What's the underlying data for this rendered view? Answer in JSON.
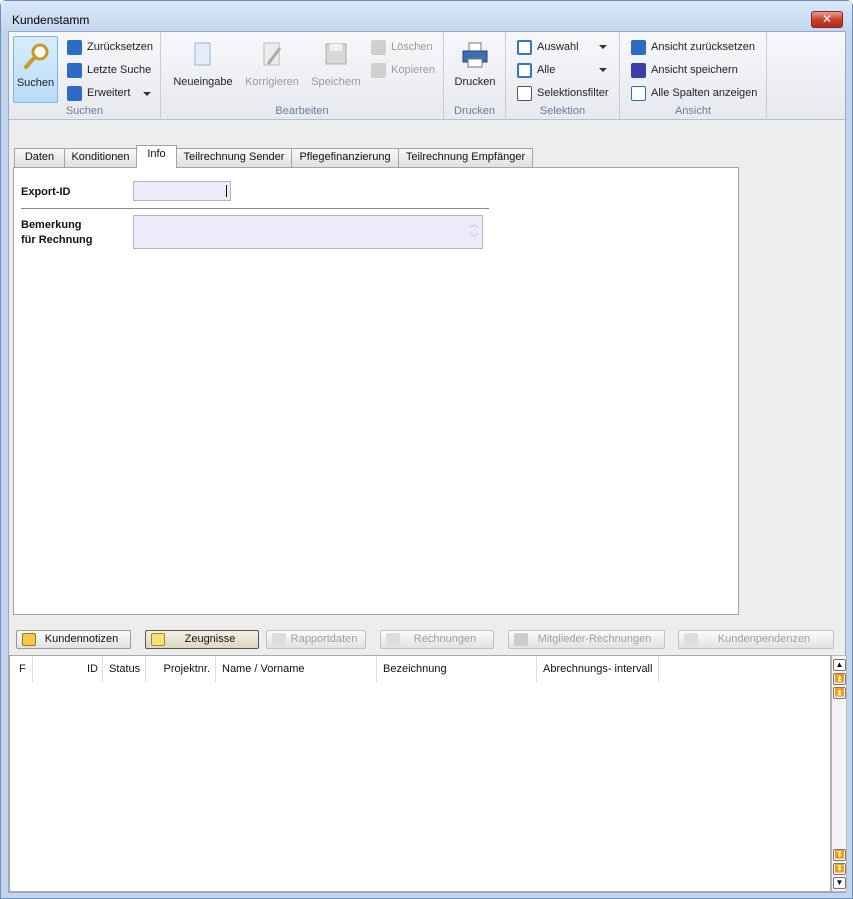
{
  "window": {
    "title": "Kundenstamm",
    "close_label": "✕"
  },
  "ribbon": {
    "suchen": {
      "label": "Suchen",
      "search_label": "Suchen",
      "reset_label": "Zurücksetzen",
      "last_label": "Letzte Suche",
      "extended_label": "Erweitert"
    },
    "bearbeiten": {
      "label": "Bearbeiten",
      "new_label": "Neueingabe",
      "correct_label": "Korrigieren",
      "save_label": "Speichern",
      "delete_label": "Löschen",
      "copy_label": "Kopieren"
    },
    "drucken": {
      "label": "Drucken",
      "print_label": "Drucken"
    },
    "selektion": {
      "label": "Selektion",
      "auswahl_label": "Auswahl",
      "alle_label": "Alle",
      "filter_label": "Selektionsfilter"
    },
    "ansicht": {
      "label": "Ansicht",
      "reset_view_label": "Ansicht zurücksetzen",
      "save_view_label": "Ansicht speichern",
      "show_cols_label": "Alle Spalten anzeigen"
    }
  },
  "tabs": [
    "Daten",
    "Konditionen",
    "Info",
    "Teilrechnung Sender",
    "Pflegefinanzierung",
    "Teilrechnung Empfänger"
  ],
  "form": {
    "export_id_label": "Export-ID",
    "export_id_value": "",
    "bemerkung_label_1": "Bemerkung",
    "bemerkung_label_2": "für Rechnung",
    "bemerkung_value": ""
  },
  "sub_buttons": [
    "Kundennotizen",
    "Zeugnisse",
    "Rapportdaten",
    "Rechnungen",
    "Mitglieder-Rechnungen",
    "Kundenpendenzen"
  ],
  "grid": {
    "columns": [
      "F",
      "ID",
      "Status",
      "Projektnr.",
      "Name / Vorname",
      "Bezeichnung",
      "Abrechnungs- intervall"
    ],
    "rows": []
  },
  "scroll": {
    "up": "▲",
    "top": "⏫",
    "pageup": "⏫",
    "pagedown": "⏬",
    "bottom": "⏬",
    "down": "▼"
  }
}
